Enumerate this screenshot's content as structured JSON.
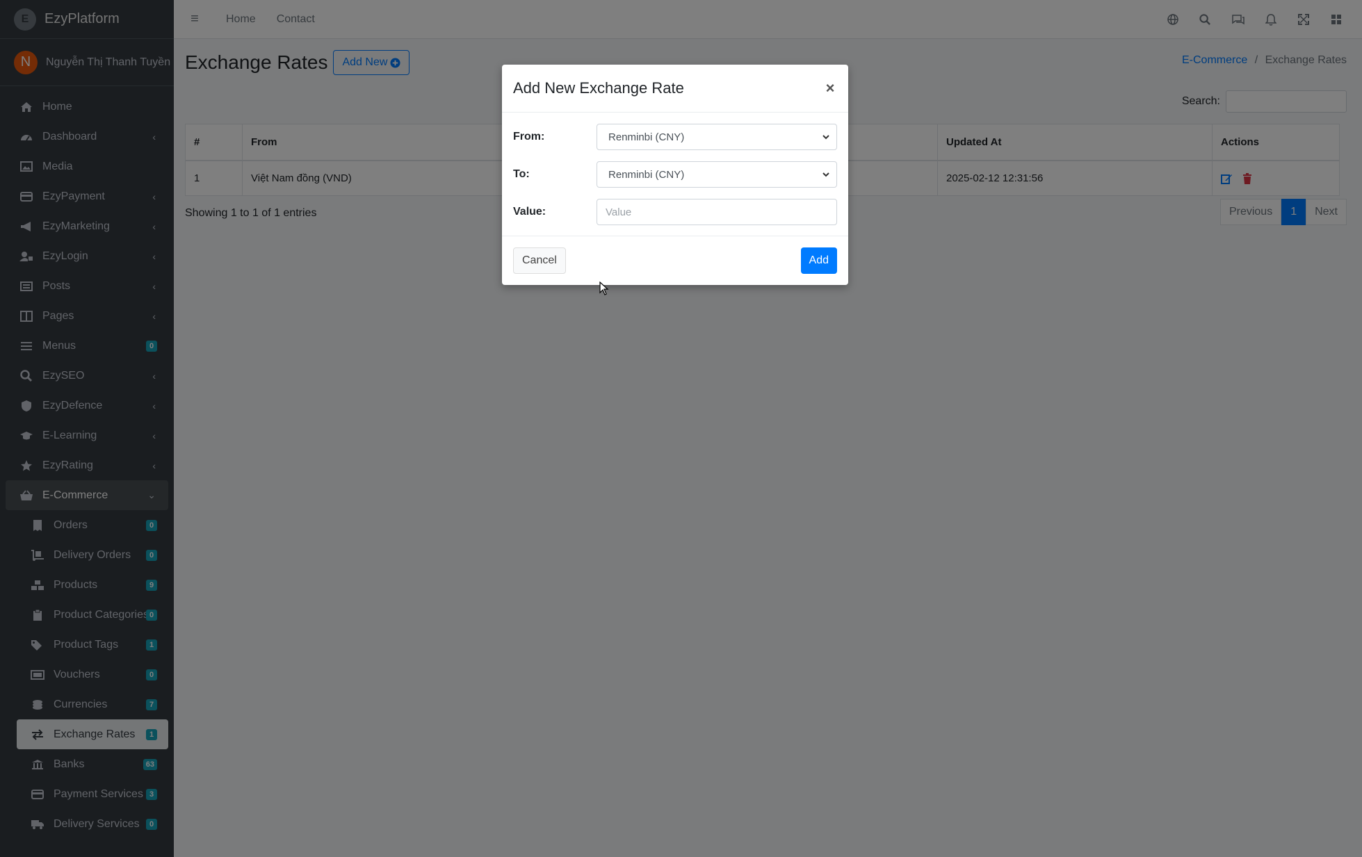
{
  "brand": {
    "name": "EzyPlatform",
    "logo_letter": "E"
  },
  "user": {
    "initial": "N",
    "name": "Nguyễn Thị Thanh Tuyền"
  },
  "sidebar": {
    "items": [
      {
        "label": "Home",
        "icon": "home-icon"
      },
      {
        "label": "Dashboard",
        "icon": "dashboard-icon",
        "chevron": true
      },
      {
        "label": "Media",
        "icon": "image-icon"
      },
      {
        "label": "EzyPayment",
        "icon": "credit-card-icon",
        "chevron": true
      },
      {
        "label": "EzyMarketing",
        "icon": "megaphone-icon",
        "chevron": true
      },
      {
        "label": "EzyLogin",
        "icon": "user-lock-icon",
        "chevron": true
      },
      {
        "label": "Posts",
        "icon": "newspaper-icon",
        "chevron": true
      },
      {
        "label": "Pages",
        "icon": "book-icon",
        "chevron": true
      },
      {
        "label": "Menus",
        "icon": "bars-icon",
        "badge": "0"
      },
      {
        "label": "EzySEO",
        "icon": "search-icon",
        "chevron": true
      },
      {
        "label": "EzyDefence",
        "icon": "shield-icon",
        "chevron": true
      },
      {
        "label": "E-Learning",
        "icon": "graduation-cap-icon",
        "chevron": true
      },
      {
        "label": "EzyRating",
        "icon": "star-icon",
        "chevron": true
      },
      {
        "label": "E-Commerce",
        "icon": "basket-icon",
        "open": true
      }
    ],
    "sub_items": [
      {
        "label": "Orders",
        "icon": "receipt-icon",
        "badge": "0"
      },
      {
        "label": "Delivery Orders",
        "icon": "dolly-icon",
        "badge": "0"
      },
      {
        "label": "Products",
        "icon": "boxes-icon",
        "badge": "9"
      },
      {
        "label": "Product Categories",
        "icon": "clipboard-icon",
        "badge": "0"
      },
      {
        "label": "Product Tags",
        "icon": "tags-icon",
        "badge": "1"
      },
      {
        "label": "Vouchers",
        "icon": "ticket-icon",
        "badge": "0"
      },
      {
        "label": "Currencies",
        "icon": "coins-icon",
        "badge": "7"
      },
      {
        "label": "Exchange Rates",
        "icon": "exchange-icon",
        "badge": "1",
        "active": true
      },
      {
        "label": "Banks",
        "icon": "bank-icon",
        "badge": "63"
      },
      {
        "label": "Payment Services",
        "icon": "credit-card-icon",
        "badge": "3"
      },
      {
        "label": "Delivery Services",
        "icon": "truck-icon",
        "badge": "0"
      }
    ]
  },
  "topbar": {
    "links": [
      "Home",
      "Contact"
    ],
    "icons": [
      "globe-icon",
      "search-icon",
      "comments-icon",
      "bell-icon",
      "expand-icon",
      "apps-icon"
    ]
  },
  "page": {
    "title": "Exchange Rates",
    "add_new_label": "Add New",
    "breadcrumb": {
      "parent": "E-Commerce",
      "separator": "/",
      "current": "Exchange Rates"
    },
    "search_label": "Search:",
    "table": {
      "headers": [
        "#",
        "From",
        "Updated At",
        "Actions"
      ],
      "rows": [
        {
          "num": "1",
          "from": "Việt Nam đồng (VND)",
          "updated_at": "2025-02-12 12:31:56"
        }
      ]
    },
    "entries_info": "Showing 1 to 1 of 1 entries",
    "pagination": {
      "previous": "Previous",
      "current": "1",
      "next": "Next"
    }
  },
  "modal": {
    "title": "Add New Exchange Rate",
    "close": "×",
    "from_label": "From:",
    "from_value": "Renminbi (CNY)",
    "to_label": "To:",
    "to_value": "Renminbi (CNY)",
    "value_label": "Value:",
    "value_placeholder": "Value",
    "cancel_label": "Cancel",
    "add_label": "Add"
  },
  "colors": {
    "primary": "#007bff",
    "sidebar_bg": "#343a40",
    "badge": "#17a2b8",
    "delete": "#dc3545"
  }
}
